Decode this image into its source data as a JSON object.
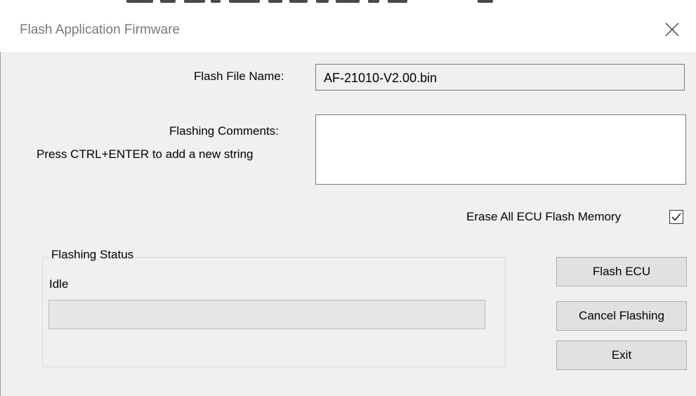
{
  "window": {
    "title": "Flash Application Firmware"
  },
  "form": {
    "flash_file_label": "Flash File Name:",
    "flash_file_value": "AF-21010-V2.00.bin",
    "comments_label": "Flashing Comments:",
    "comments_hint": "Press CTRL+ENTER to add a new string",
    "comments_value": "",
    "erase_label": "Erase All ECU Flash Memory",
    "erase_checked": true
  },
  "status": {
    "group_label": "Flashing Status",
    "state_text": "Idle",
    "progress_percent": 0
  },
  "buttons": {
    "flash_label": "Flash ECU",
    "cancel_label": "Cancel Flashing",
    "exit_label": "Exit"
  },
  "icons": {
    "close": "close-icon",
    "check": "checkmark-icon"
  },
  "colors": {
    "dialog_bg": "#f0f0f0",
    "titlebar_bg": "#ffffff",
    "title_text": "#7a7a7a",
    "button_bg": "#e1e1e1",
    "button_border": "#adadad"
  }
}
